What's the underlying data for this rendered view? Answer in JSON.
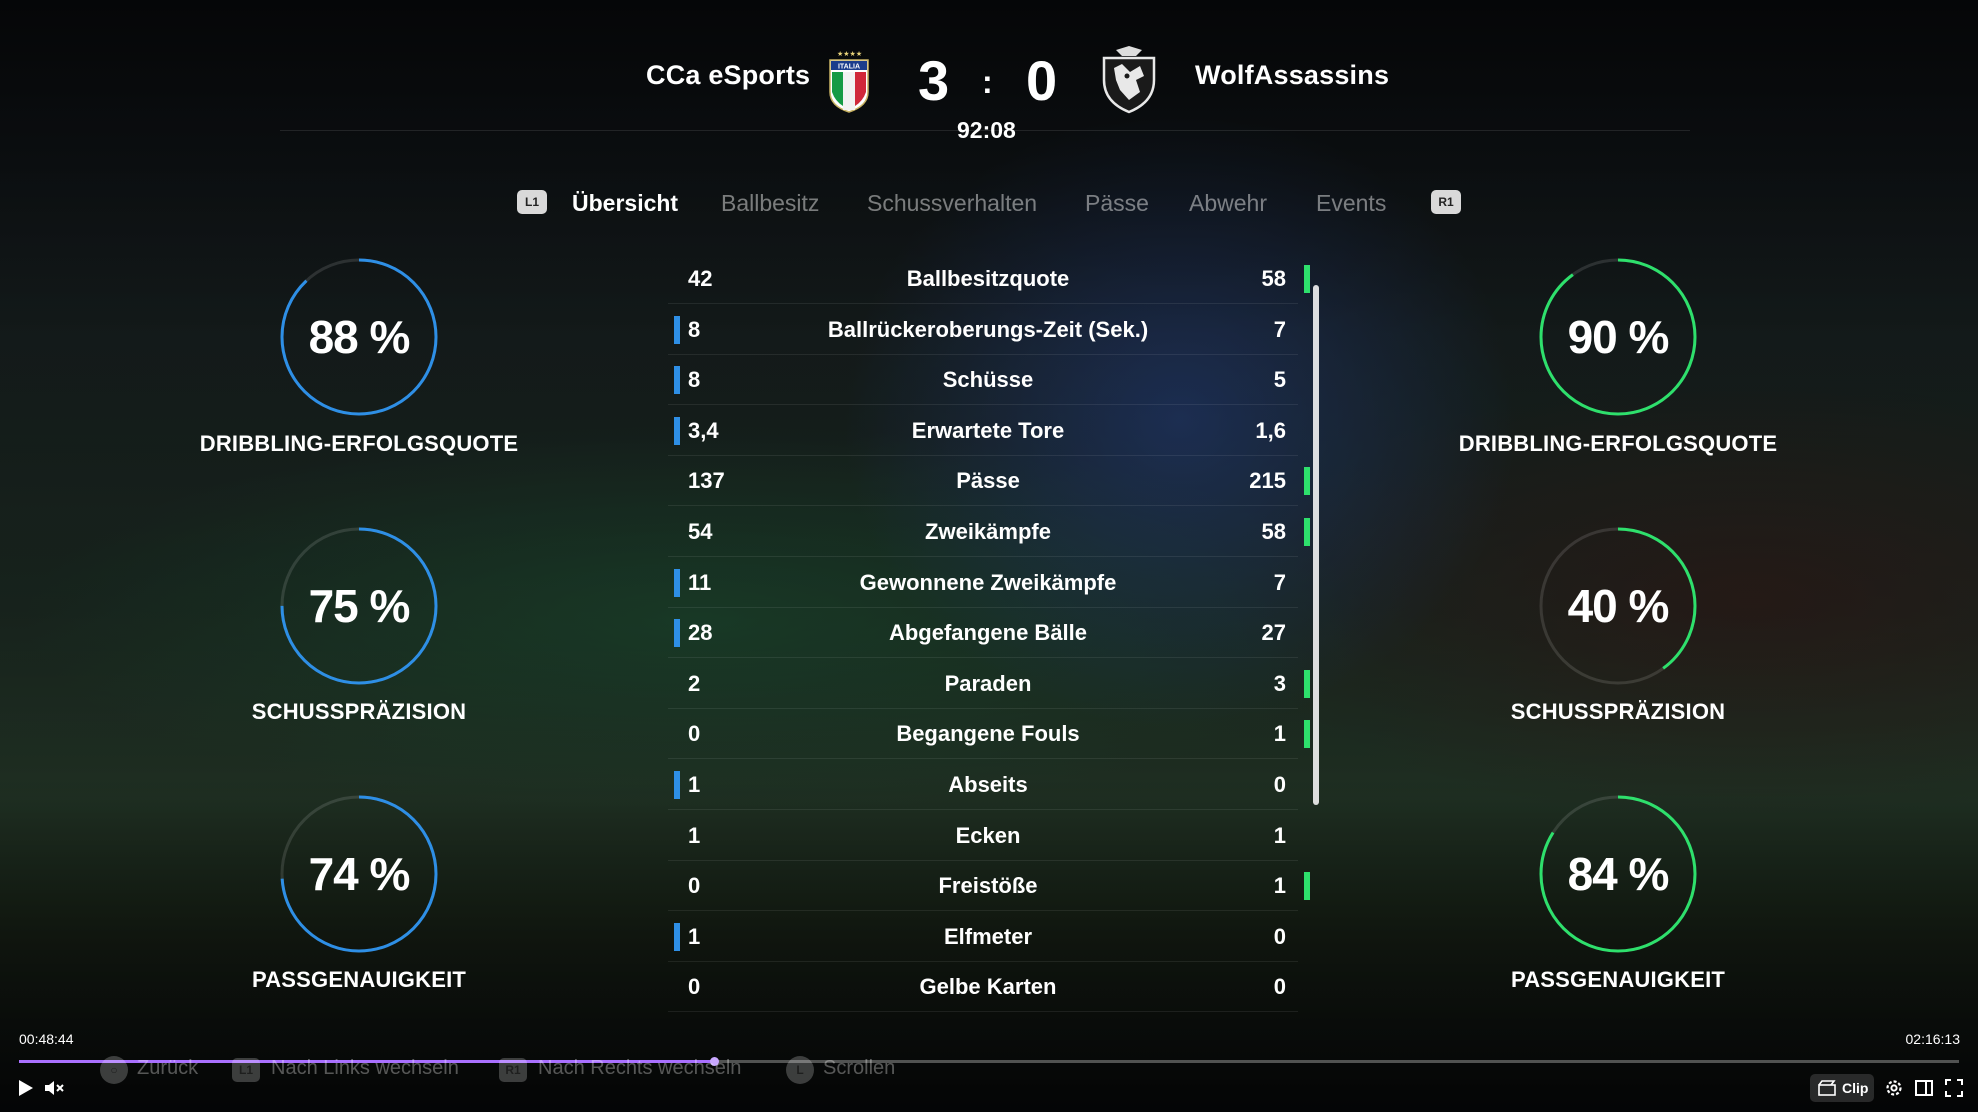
{
  "header": {
    "home_team": "CCa eSports",
    "away_team": "WolfAssassins",
    "home_crest_text": "ITALIA",
    "home_score": "3",
    "separator": ":",
    "away_score": "0",
    "clock": "92:08"
  },
  "tabs": {
    "left_shoulder": "L1",
    "right_shoulder": "R1",
    "items": [
      "Übersicht",
      "Ballbesitz",
      "Schussverhalten",
      "Pässe",
      "Abwehr",
      "Events"
    ],
    "active_index": 0
  },
  "rings": {
    "home": [
      {
        "value": "88 %",
        "fraction": 0.88,
        "label": "DRIBBLING-ERFOLGSQUOTE"
      },
      {
        "value": "75 %",
        "fraction": 0.75,
        "label": "SCHUSSPRÄZISION"
      },
      {
        "value": "74 %",
        "fraction": 0.74,
        "label": "PASSGENAUIGKEIT"
      }
    ],
    "away": [
      {
        "value": "90 %",
        "fraction": 0.9,
        "label": "DRIBBLING-ERFOLGSQUOTE"
      },
      {
        "value": "40 %",
        "fraction": 0.4,
        "label": "SCHUSSPRÄZISION"
      },
      {
        "value": "84 %",
        "fraction": 0.84,
        "label": "PASSGENAUIGKEIT"
      }
    ],
    "home_color": "#2e8fe6",
    "away_color": "#2ee06c"
  },
  "stats": [
    {
      "home": "42",
      "name": "Ballbesitzquote",
      "away": "58",
      "leader": "away"
    },
    {
      "home": "8",
      "name": "Ballrückeroberungs-Zeit (Sek.)",
      "away": "7",
      "leader": "home"
    },
    {
      "home": "8",
      "name": "Schüsse",
      "away": "5",
      "leader": "home"
    },
    {
      "home": "3,4",
      "name": "Erwartete Tore",
      "away": "1,6",
      "leader": "home"
    },
    {
      "home": "137",
      "name": "Pässe",
      "away": "215",
      "leader": "away"
    },
    {
      "home": "54",
      "name": "Zweikämpfe",
      "away": "58",
      "leader": "away"
    },
    {
      "home": "11",
      "name": "Gewonnene Zweikämpfe",
      "away": "7",
      "leader": "home"
    },
    {
      "home": "28",
      "name": "Abgefangene Bälle",
      "away": "27",
      "leader": "home"
    },
    {
      "home": "2",
      "name": "Paraden",
      "away": "3",
      "leader": "away"
    },
    {
      "home": "0",
      "name": "Begangene Fouls",
      "away": "1",
      "leader": "away"
    },
    {
      "home": "1",
      "name": "Abseits",
      "away": "0",
      "leader": "home"
    },
    {
      "home": "1",
      "name": "Ecken",
      "away": "1",
      "leader": "none"
    },
    {
      "home": "0",
      "name": "Freistöße",
      "away": "1",
      "leader": "away"
    },
    {
      "home": "1",
      "name": "Elfmeter",
      "away": "0",
      "leader": "home"
    },
    {
      "home": "0",
      "name": "Gelbe Karten",
      "away": "0",
      "leader": "none"
    }
  ],
  "player": {
    "current_time": "00:48:44",
    "total_time": "02:16:13",
    "progress_fraction": 0.358,
    "clip_label": "Clip"
  },
  "hints": [
    {
      "button": "○",
      "label": "Zurück"
    },
    {
      "button": "L1",
      "label": "Nach Links wechseln"
    },
    {
      "button": "R1",
      "label": "Nach Rechts wechseln"
    },
    {
      "button": "L",
      "label": "Scrollen"
    }
  ]
}
